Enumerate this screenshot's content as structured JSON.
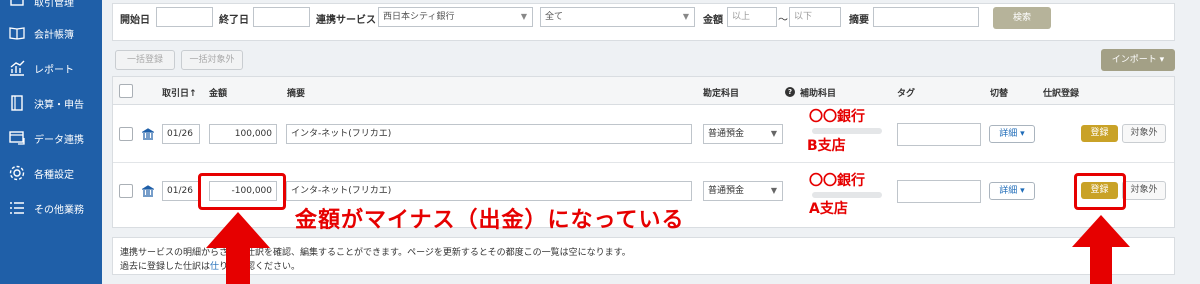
{
  "sidebar": {
    "items": [
      {
        "label": "取引管理",
        "icon": "cart-icon"
      },
      {
        "label": "会計帳簿",
        "icon": "book-icon"
      },
      {
        "label": "レポート",
        "icon": "report-icon"
      },
      {
        "label": "決算・申告",
        "icon": "settlement-icon"
      },
      {
        "label": "データ連携",
        "icon": "data-link-icon"
      },
      {
        "label": "各種設定",
        "icon": "gear-icon"
      },
      {
        "label": "その他業務",
        "icon": "list-icon"
      }
    ]
  },
  "filter": {
    "start_label": "開始日",
    "end_label": "終了日",
    "service_label": "連携サービス",
    "service_value": "西日本シティ銀行",
    "type_value": "全て",
    "amount_label": "金額",
    "amount_min_placeholder": "以上",
    "tilde": "〜",
    "amount_max_placeholder": "以下",
    "memo_label": "摘要",
    "search_label": "検索"
  },
  "toolbar": {
    "bulk_register": "一括登録",
    "bulk_exclude": "一括対象外",
    "import_label": "インポート ▾"
  },
  "table": {
    "headers": {
      "date": "取引日",
      "date_sort": "↑",
      "amount": "金額",
      "memo": "摘要",
      "account": "勘定科目",
      "help": "?",
      "sub_account": "補助科目",
      "tag": "タグ",
      "toggle": "切替",
      "register": "仕訳登録"
    },
    "rows": [
      {
        "date": "01/26",
        "amount": "100,000",
        "memo": "インタ-ネット(フリカエ)",
        "account": "普通預金",
        "bank_name": "〇〇銀行",
        "branch": "B支店",
        "detail": "詳細 ▾",
        "register": "登録",
        "exclude": "対象外"
      },
      {
        "date": "01/26",
        "amount": "-100,000",
        "memo": "インタ-ネット(フリカエ)",
        "account": "普通預金",
        "bank_name": "〇〇銀行",
        "branch": "A支店",
        "detail": "詳細 ▾",
        "register": "登録",
        "exclude": "対象外"
      }
    ]
  },
  "info": {
    "line1": "連携サービスの明細からされた仕訳を確認、編集することができます。ページを更新するとその都度この一覧は空になります。",
    "line2_prefix": "過去に登録した仕訳は",
    "line2_link": "仕",
    "line2_suffix": "りご確認ください。"
  },
  "annotation": {
    "text": "金額がマイナス（出金）になっている"
  },
  "colors": {
    "sidebar": "#1f5fa8",
    "register_button": "#c9a227",
    "annotation": "#e60000"
  }
}
